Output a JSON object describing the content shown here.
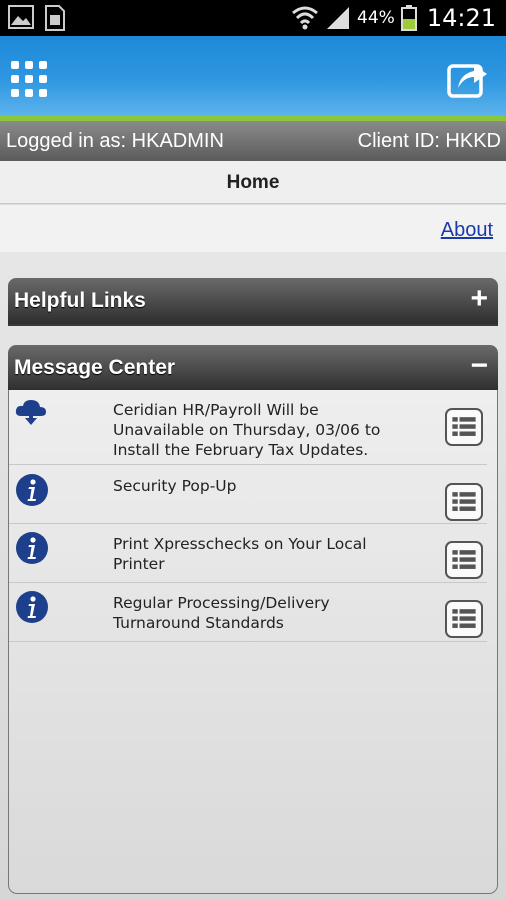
{
  "status_bar": {
    "battery_percent": "44%",
    "time": "14:21",
    "left_icons": [
      "gallery-icon",
      "sim-card-icon"
    ],
    "right_icons": [
      "wifi-icon",
      "signal-icon",
      "battery-icon"
    ]
  },
  "app_bar": {
    "menu_icon": "grid-menu-icon",
    "share_icon": "share-icon",
    "accent_color": "#2f97e1",
    "strip_color": "#8cc63f"
  },
  "login": {
    "logged_in_label": "Logged in as: HKADMIN",
    "client_label": "Client ID: HKKD"
  },
  "home": {
    "title": "Home",
    "about_link": "About"
  },
  "helpful_links": {
    "title": "Helpful Links",
    "toggle": "+"
  },
  "message_center": {
    "title": "Message Center",
    "toggle": "−",
    "messages": [
      {
        "icon": "cloud-download-icon",
        "text": "Ceridian HR/Payroll Will be Unavailable on Thursday, 03/06 to Install the February Tax Updates."
      },
      {
        "icon": "info-icon",
        "text": "Security Pop-Up"
      },
      {
        "icon": "info-icon",
        "text": "Print Xpresschecks on Your Local Printer"
      },
      {
        "icon": "info-icon",
        "text": "Regular Processing/Delivery Turnaround Standards"
      }
    ]
  }
}
